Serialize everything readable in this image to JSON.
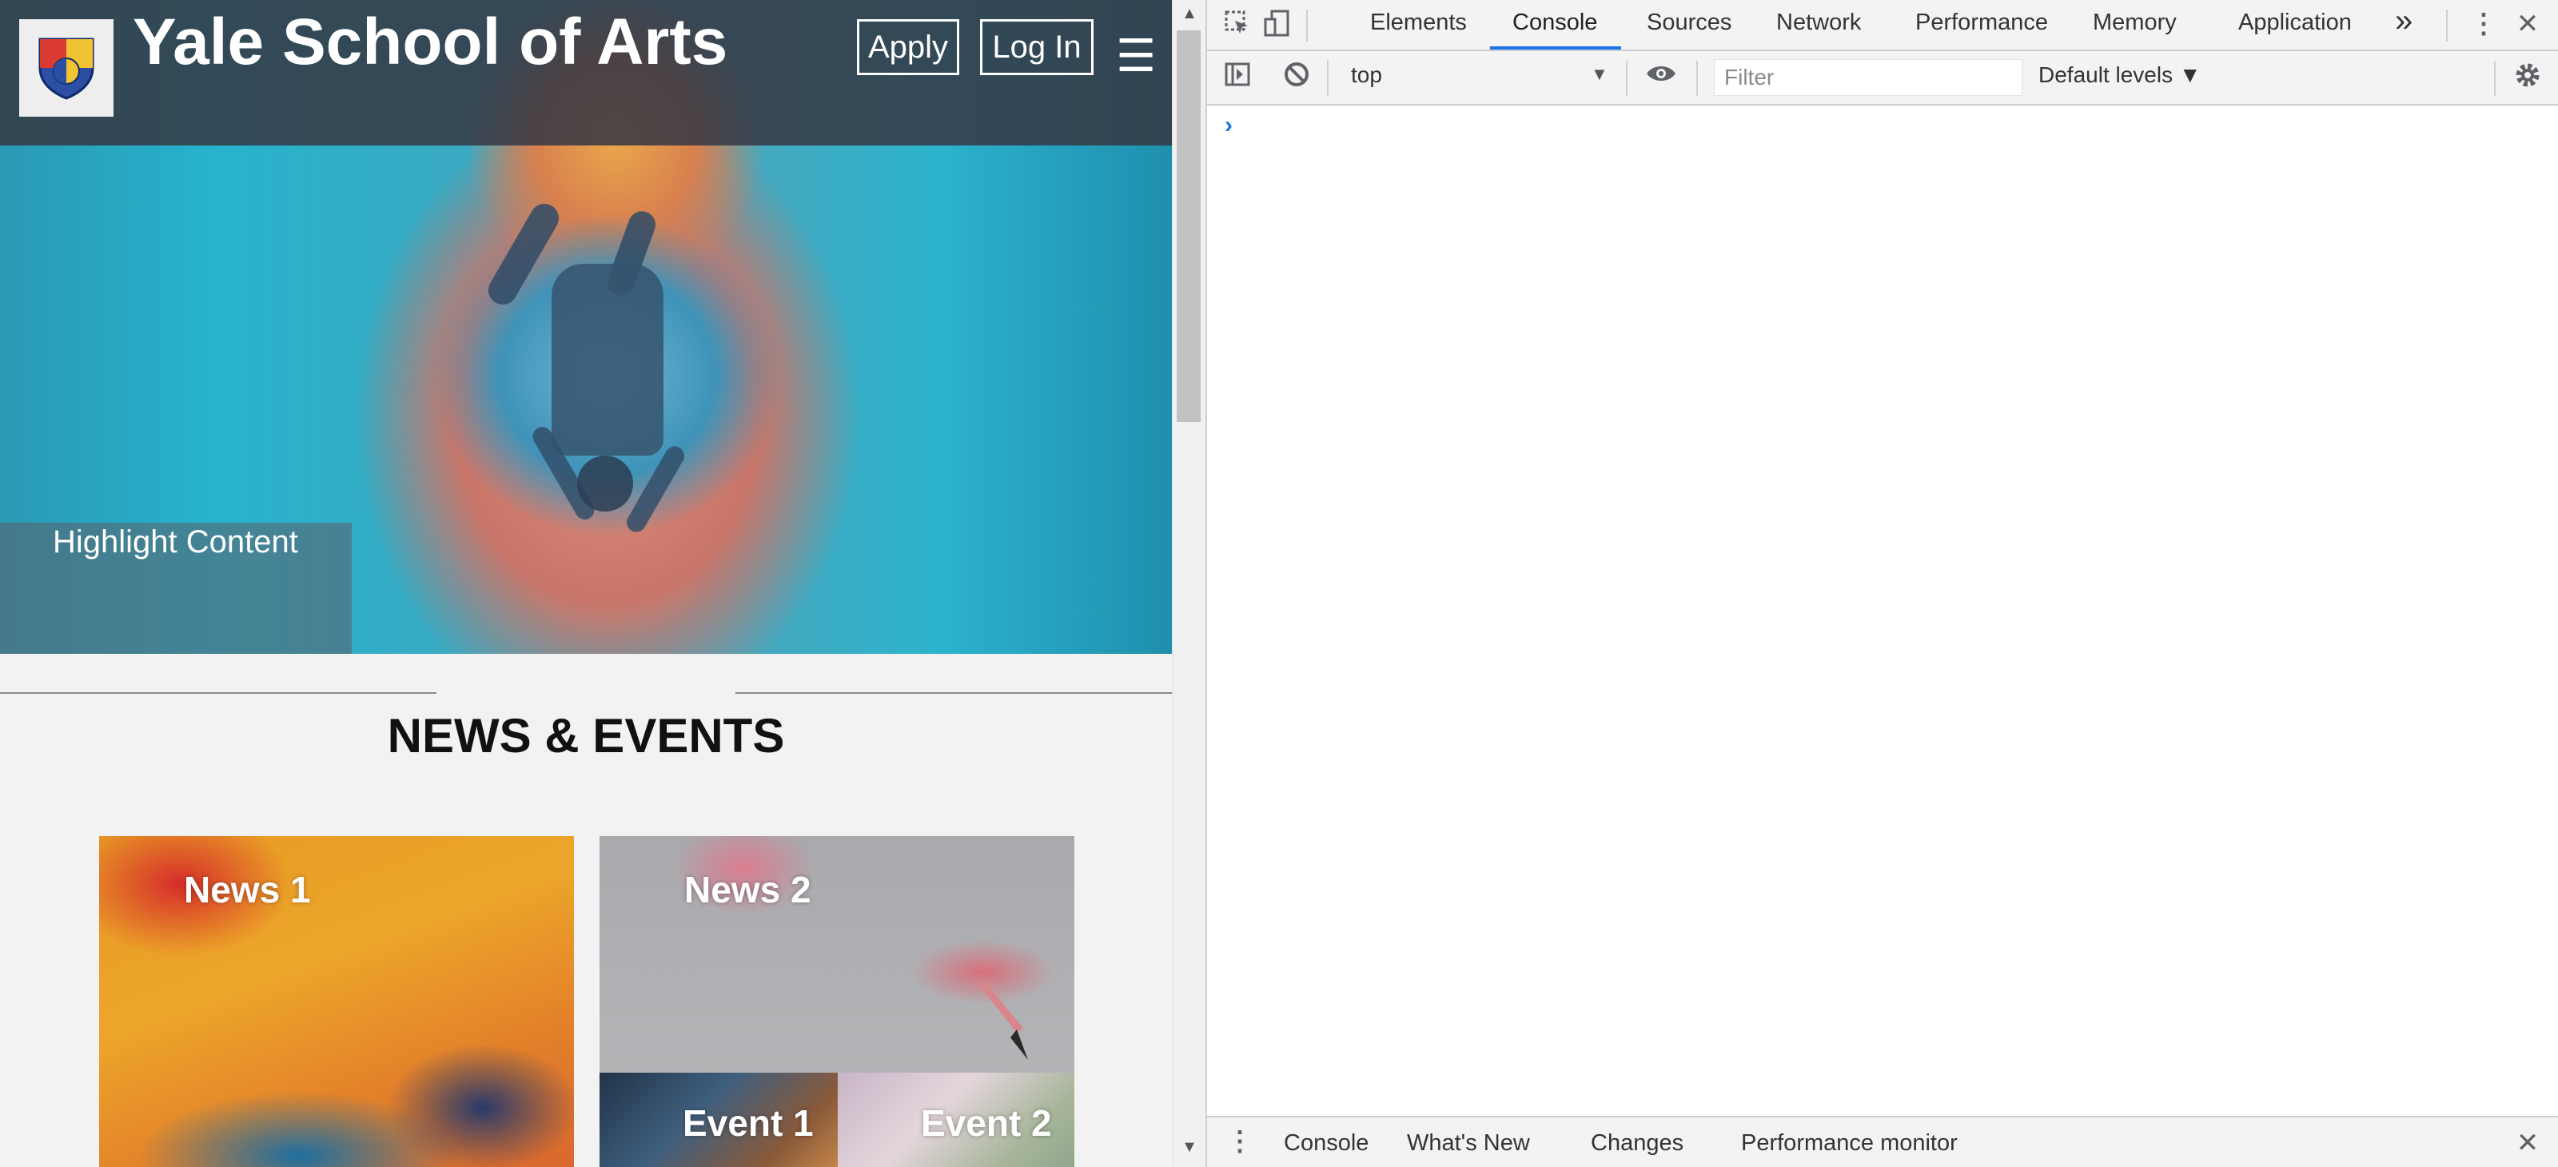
{
  "site": {
    "title": "Yale School of Arts",
    "apply_label": "Apply",
    "login_label": "Log In",
    "menu_glyph": "☰",
    "highlight_label": "Highlight Content",
    "news_heading": "NEWS & EVENTS",
    "cards": {
      "news1": "News 1",
      "news2": "News 2",
      "event1": "Event 1",
      "event2": "Event 2"
    },
    "colors": {
      "header_bg": "#343844",
      "accent_blue": "#1a73e8"
    }
  },
  "devtools": {
    "tabs": [
      "Elements",
      "Console",
      "Sources",
      "Network",
      "Performance",
      "Memory",
      "Application"
    ],
    "active_tab": "Console",
    "more_tabs_glyph": "»",
    "toolbar": {
      "context": "top",
      "filter_placeholder": "Filter",
      "levels": "Default levels ▼"
    },
    "prompt_glyph": "›",
    "drawer_tabs": [
      "Console",
      "What's New",
      "Changes",
      "Performance monitor"
    ],
    "icons": [
      "inspect-element-icon",
      "device-toolbar-icon",
      "more-vertical-icon",
      "close-icon",
      "sidebar-toggle-icon",
      "clear-console-icon",
      "eye-icon",
      "gear-icon"
    ]
  }
}
